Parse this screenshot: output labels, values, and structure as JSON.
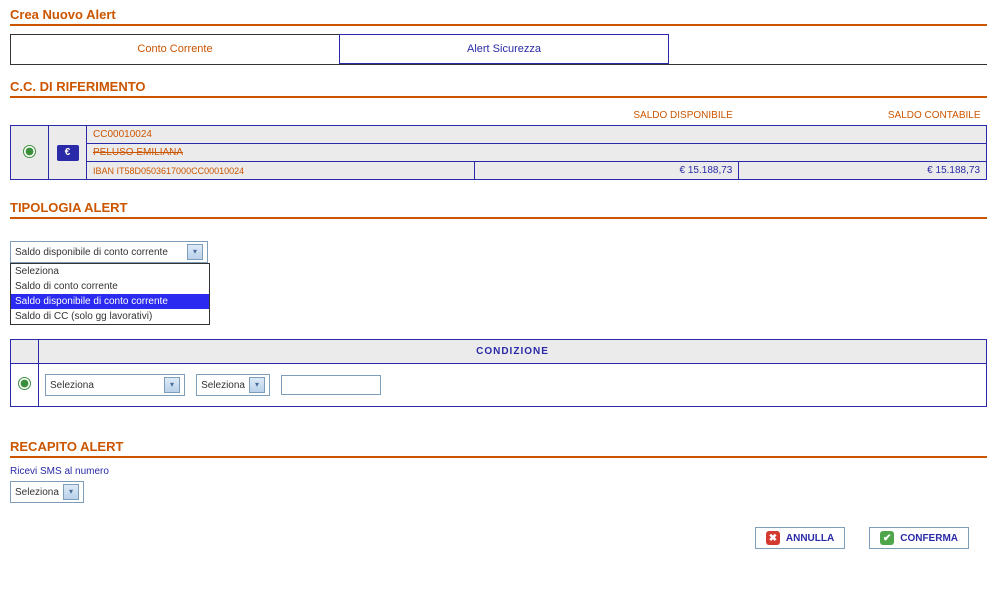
{
  "page_title": "Crea Nuovo Alert",
  "tabs": {
    "conto": "Conto Corrente",
    "sicurezza": "Alert Sicurezza"
  },
  "sections": {
    "cc_rif": "C.C. DI RIFERIMENTO",
    "tipologia": "TIPOLOGIA ALERT",
    "recapito": "RECAPITO ALERT"
  },
  "account_headers": {
    "disp": "SALDO DISPONIBILE",
    "cont": "SALDO CONTABILE"
  },
  "account": {
    "code": "CC00010024",
    "name": "PELUSO EMILIANA",
    "iban": "IBAN IT58D0503617000CC00010024",
    "disp": "€ 15.188,73",
    "cont": "€ 15.188,73",
    "euro_icon": "€"
  },
  "tipologia_select": {
    "value": "Saldo disponibile di conto corrente",
    "options": [
      "Seleziona",
      "Saldo di conto corrente",
      "Saldo disponibile di conto corrente",
      "Saldo di CC (solo gg lavorativi)"
    ],
    "selected_index": 2
  },
  "condition": {
    "header": "CONDIZIONE",
    "select1": "Seleziona",
    "select2": "Seleziona"
  },
  "recapito": {
    "label": "Ricevi SMS al numero",
    "value": "Seleziona"
  },
  "buttons": {
    "annulla": "ANNULLA",
    "conferma": "CONFERMA"
  }
}
